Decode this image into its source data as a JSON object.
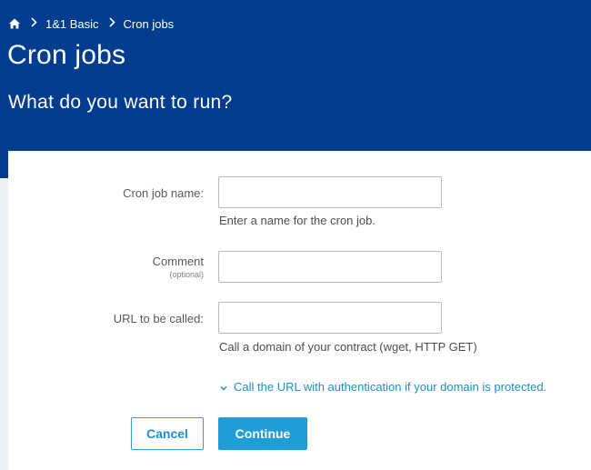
{
  "breadcrumb": {
    "home_icon": "home-icon",
    "items": [
      "1&1 Basic",
      "Cron jobs"
    ]
  },
  "header": {
    "title": "Cron jobs",
    "subtitle": "What do you want to run?"
  },
  "form": {
    "name": {
      "label": "Cron job name:",
      "value": "",
      "hint": "Enter a name for the cron job."
    },
    "comment": {
      "label": "Comment",
      "sublabel": "(optional)",
      "value": ""
    },
    "url": {
      "label": "URL to be called:",
      "value": "",
      "hint": "Call a domain of your contract (wget, HTTP GET)"
    },
    "auth_link": "Call the URL with authentication if your domain is protected."
  },
  "buttons": {
    "cancel": "Cancel",
    "continue": "Continue"
  },
  "colors": {
    "header_bg": "#003d8f",
    "accent": "#1e9ed6",
    "link": "#1e8fc6"
  }
}
